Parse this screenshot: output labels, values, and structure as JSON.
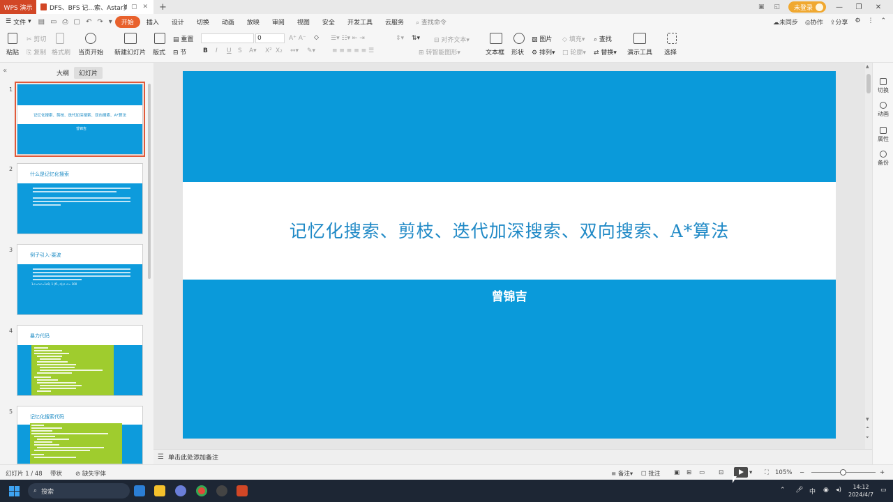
{
  "titlebar": {
    "app_badge": "WPS 演示",
    "doc_tab": "DFS、BFS 记...索、Astar算法",
    "login": "未登录"
  },
  "menu": {
    "file": "文件",
    "tabs": [
      "开始",
      "插入",
      "设计",
      "切换",
      "动画",
      "放映",
      "审阅",
      "视图",
      "安全",
      "开发工具",
      "云服务"
    ],
    "search": "查找命令",
    "right": [
      "未同步",
      "协作",
      "分享"
    ]
  },
  "ribbon": {
    "paste": "粘贴",
    "cut": "剪切",
    "copy": "复制",
    "format_painter": "格式刷",
    "from_current": "当页开始",
    "new_slide": "新建幻灯片",
    "layout": "版式",
    "reset": "重置",
    "section": "节",
    "font_size": "0",
    "align_text": "对齐文本",
    "to_smartart": "转智能图形",
    "textbox": "文本框",
    "shape": "形状",
    "picture": "图片",
    "arrange": "排列",
    "fill": "填充",
    "outline": "轮廓",
    "find": "查找",
    "replace": "替换",
    "presenter_tools": "演示工具",
    "select": "选择"
  },
  "left_panel": {
    "tab_outline": "大纲",
    "tab_slides": "幻灯片",
    "thumbs": [
      {
        "num": "1",
        "title": "记忆化搜索、剪枝、迭代加深搜索、双向搜索、A*算法",
        "sub": "曾锦吉"
      },
      {
        "num": "2",
        "title": "什么是记忆化搜索"
      },
      {
        "num": "3",
        "title": "例子引入-斐波",
        "sub": "1<=n<=1e9, 1 (f1, n),n <= 100"
      },
      {
        "num": "4",
        "title": "暴力代码"
      },
      {
        "num": "5",
        "title": "记忆化搜索代码"
      }
    ]
  },
  "slide": {
    "title": "记忆化搜索、剪枝、迭代加深搜索、双向搜索、A*算法",
    "author": "曾锦吉"
  },
  "right_panel": [
    "切换",
    "动画",
    "属性",
    "备份"
  ],
  "notes": {
    "placeholder": "单击此处添加备注"
  },
  "status": {
    "slide_indicator": "幻灯片 1 / 48",
    "theme": "带状",
    "missing_font": "缺失字体",
    "notes_btn": "备注",
    "comments_btn": "批注",
    "zoom": "105%"
  },
  "taskbar": {
    "search": "搜索",
    "ime": "中",
    "time": "14:12",
    "date": "2024/4/7"
  },
  "colors": {
    "accent": "#e8612c",
    "slide_blue": "#0a9ada",
    "title_blue": "#1f89c6",
    "code_green": "#9fcc2e"
  }
}
